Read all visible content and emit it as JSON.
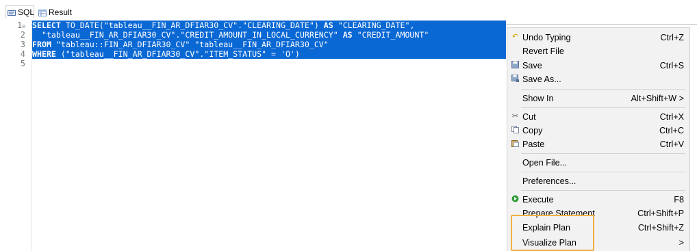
{
  "tabs": [
    {
      "label": "SQL",
      "icon": "sql-icon"
    },
    {
      "label": "Result",
      "icon": "result-table-icon"
    }
  ],
  "editor": {
    "line_numbers": [
      "1",
      "2",
      "3",
      "4",
      "5"
    ],
    "line1_kw1": "SELECT",
    "line1_rest": " TO_DATE(\"tableau__FIN_AR_DFIAR30_CV\".\"CLEARING_DATE\") ",
    "line1_kw2": "AS",
    "line1_tail": " \"CLEARING_DATE\",",
    "line2_rest": "  \"tableau__FIN_AR_DFIAR30_CV\".\"CREDIT_AMOUNT_IN_LOCAL_CURRENCY\" ",
    "line2_kw": "AS",
    "line2_tail": " \"CREDIT_AMOUNT\"",
    "line3_kw": "FROM",
    "line3_rest": " \"tableau::FIN_AR_DFIAR30_CV\" \"tableau__FIN_AR_DFIAR30_CV\"",
    "line4_kw": "WHERE",
    "line4_rest": " (\"tableau__FIN_AR_DFIAR30_CV\".\"ITEM_STATUS\" = 'O')",
    "fold_marker": "⊖"
  },
  "context_menu": {
    "undo": {
      "label": "Undo Typing",
      "shortcut": "Ctrl+Z",
      "icon": "undo-icon"
    },
    "revert": {
      "label": "Revert File"
    },
    "save": {
      "label": "Save",
      "shortcut": "Ctrl+S",
      "icon": "save-icon"
    },
    "save_as": {
      "label": "Save As...",
      "icon": "save-as-icon"
    },
    "show_in": {
      "label": "Show In",
      "shortcut": "Alt+Shift+W >"
    },
    "cut": {
      "label": "Cut",
      "shortcut": "Ctrl+X",
      "icon": "cut-icon"
    },
    "copy": {
      "label": "Copy",
      "shortcut": "Ctrl+C",
      "icon": "copy-icon"
    },
    "paste": {
      "label": "Paste",
      "shortcut": "Ctrl+V",
      "icon": "paste-icon"
    },
    "open_file": {
      "label": "Open File..."
    },
    "preferences": {
      "label": "Preferences..."
    },
    "execute": {
      "label": "Execute",
      "shortcut": "F8",
      "icon": "execute-icon"
    },
    "prepare": {
      "label": "Prepare Statement",
      "shortcut": "Ctrl+Shift+P"
    },
    "explain": {
      "label": "Explain Plan",
      "shortcut": "Ctrl+Shift+Z"
    },
    "visualize": {
      "label": "Visualize Plan",
      "shortcut": ">"
    }
  },
  "colors": {
    "selection": "#0a68d4",
    "highlight": "#f0b042",
    "menu_bg": "#f2f2f2"
  }
}
